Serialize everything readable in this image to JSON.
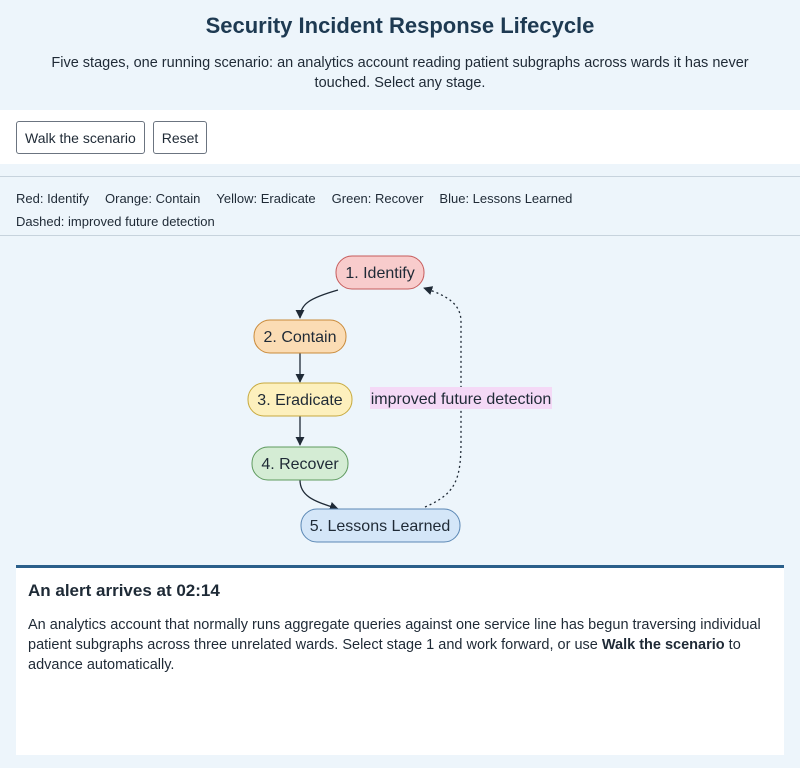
{
  "header": {
    "title": "Security Incident Response Lifecycle",
    "subtitle": "Five stages, one running scenario: an analytics account reading patient subgraphs across wards it has never touched. Select any stage."
  },
  "controls": {
    "walk_label": "Walk the scenario",
    "reset_label": "Reset"
  },
  "legend": {
    "items": [
      "Red: Identify",
      "Orange: Contain",
      "Yellow: Eradicate",
      "Green: Recover",
      "Blue: Lessons Learned"
    ],
    "dashed_note": "Dashed: improved future detection"
  },
  "diagram": {
    "stages": [
      {
        "label": "1. Identify",
        "fill": "#f8cccc",
        "stroke": "#c65b5b"
      },
      {
        "label": "2. Contain",
        "fill": "#fbdcb4",
        "stroke": "#c98a3a"
      },
      {
        "label": "3. Eradicate",
        "fill": "#fdf0bd",
        "stroke": "#c7a93e"
      },
      {
        "label": "4. Recover",
        "fill": "#d4ecd4",
        "stroke": "#5e9a5e"
      },
      {
        "label": "5. Lessons Learned",
        "fill": "#d4e6f8",
        "stroke": "#5a87b4"
      }
    ],
    "feedback_label": "improved future detection",
    "feedback_label_bg": "#f4d9f6"
  },
  "panel": {
    "title": "An alert arrives at 02:14",
    "body_before": "An analytics account that normally runs aggregate queries against one service line has begun traversing individual patient subgraphs across three unrelated wards. Select stage 1 and work forward, or use ",
    "body_strong": "Walk the scenario",
    "body_after": " to advance automatically."
  }
}
